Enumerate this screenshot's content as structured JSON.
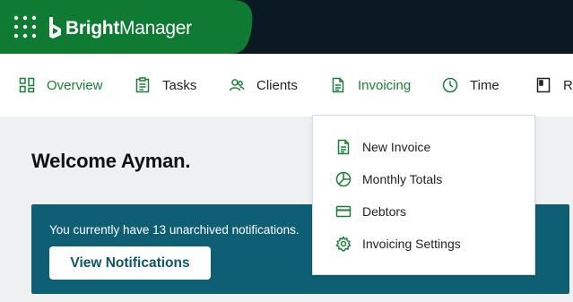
{
  "app": {
    "brand_bold": "Bright",
    "brand_thin": "Manager",
    "brand_color": "#0e7a32",
    "header_color": "#0b1a22"
  },
  "nav": {
    "items": [
      {
        "label": "Overview",
        "icon": "overview-grid-icon",
        "active": true
      },
      {
        "label": "Tasks",
        "icon": "clipboard-icon"
      },
      {
        "label": "Clients",
        "icon": "users-icon"
      },
      {
        "label": "Invoicing",
        "icon": "document-icon",
        "active": true
      },
      {
        "label": "Time",
        "icon": "clock-icon"
      },
      {
        "label": "Re",
        "icon": "report-icon"
      }
    ]
  },
  "main": {
    "welcome": "Welcome Ayman.",
    "notice_text": "You currently have 13 unarchived notifications.",
    "notice_button": "View Notifications",
    "notice_color": "#0e5f74"
  },
  "invoicing_menu": {
    "items": [
      {
        "label": "New Invoice",
        "icon": "document-icon"
      },
      {
        "label": "Monthly Totals",
        "icon": "pie-chart-icon"
      },
      {
        "label": "Debtors",
        "icon": "credit-card-icon"
      },
      {
        "label": "Invoicing Settings",
        "icon": "gear-icon"
      }
    ]
  }
}
